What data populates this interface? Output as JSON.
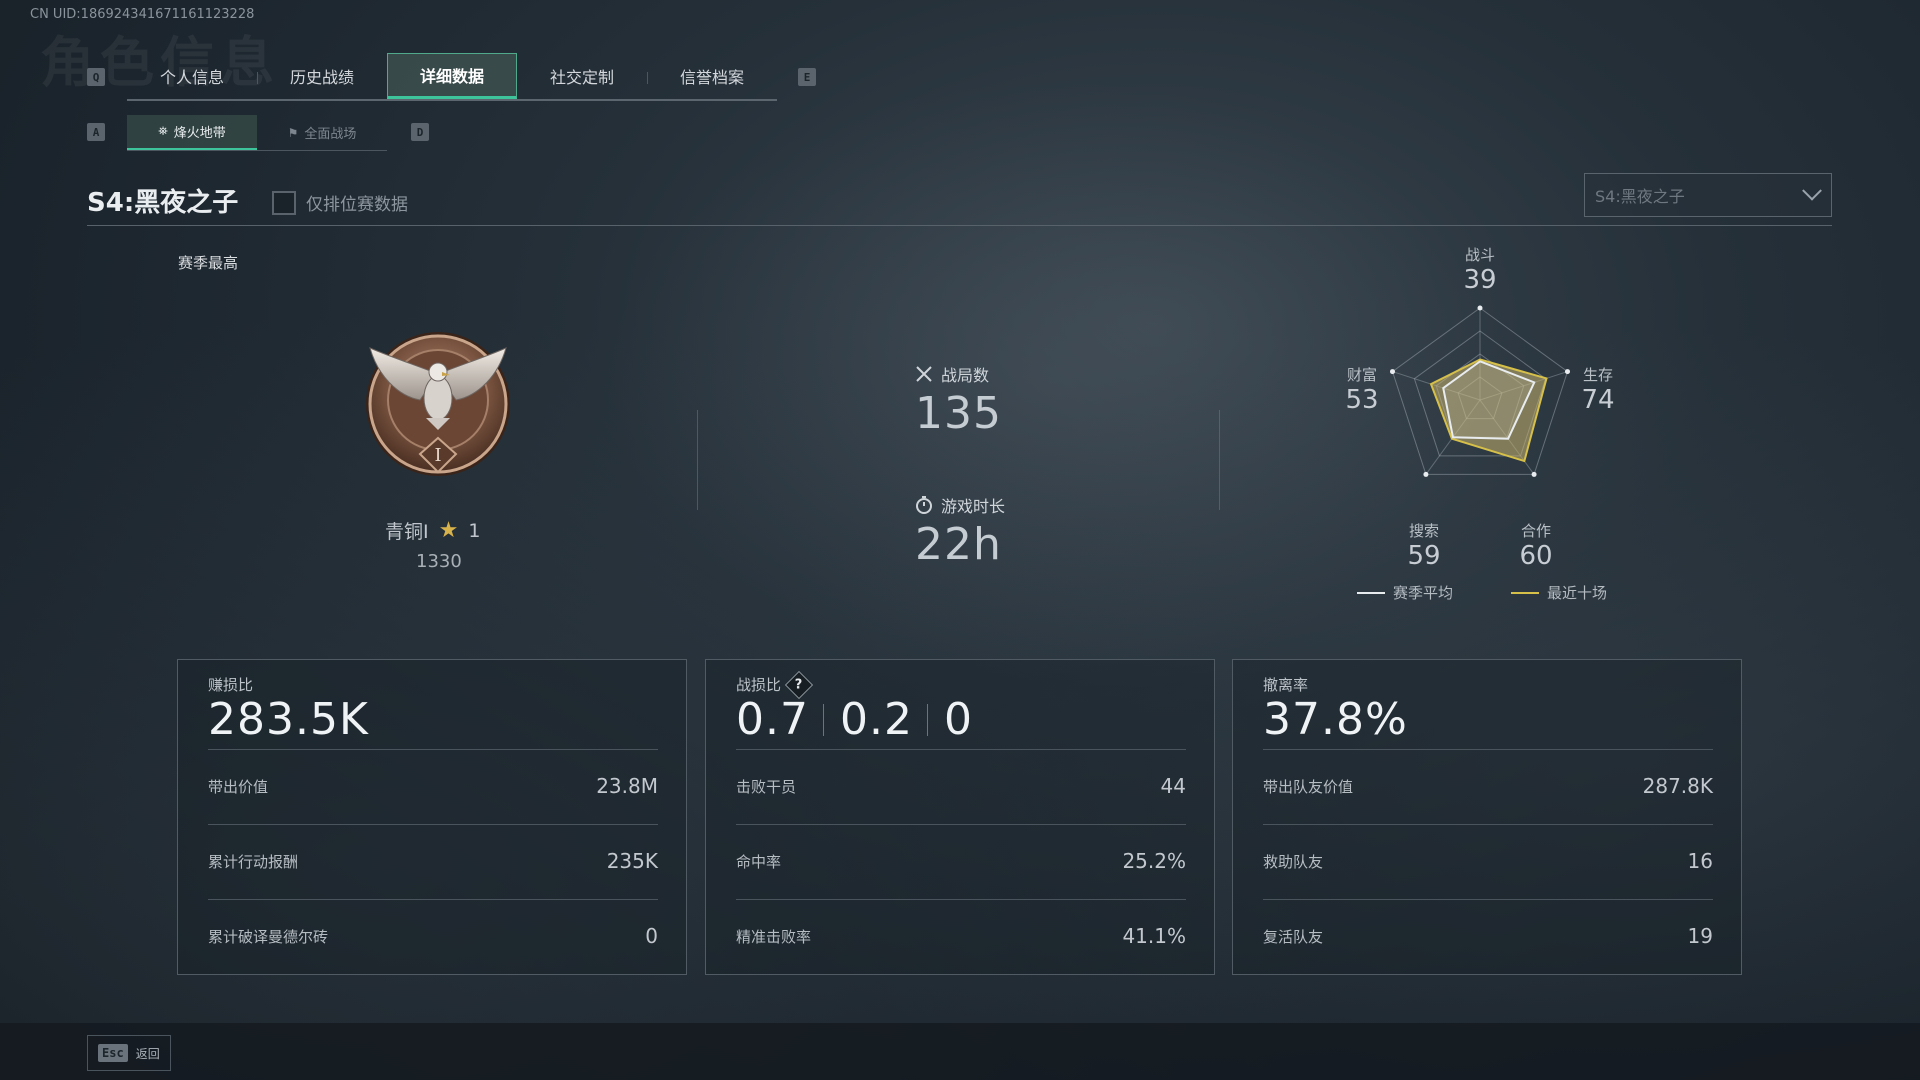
{
  "uid": "CN UID:18692434167116112322​8",
  "ghost_title": "角色信息",
  "tabs": {
    "prev_key": "Q",
    "next_key": "E",
    "items": [
      {
        "label": "个人信息"
      },
      {
        "label": "历史战绩"
      },
      {
        "label": "详细数据"
      },
      {
        "label": "社交定制"
      },
      {
        "label": "信誉档案"
      }
    ]
  },
  "subtabs": {
    "prev_key": "A",
    "next_key": "D",
    "items": [
      {
        "label": "烽火地带",
        "icon": "satellite-icon"
      },
      {
        "label": "全面战场",
        "icon": "crossed-flags-icon"
      }
    ]
  },
  "season": {
    "title": "S4:黑夜之子",
    "rank_only_label": "仅排位赛数据",
    "select_value": "S4:黑夜之子"
  },
  "season_best": {
    "label": "赛季最高",
    "rank_name": "青铜I",
    "stars": "1",
    "points": "1330"
  },
  "overview": {
    "matches_label": "战局数",
    "matches_value": "135",
    "playtime_label": "游戏时长",
    "playtime_value": "22h"
  },
  "radar": {
    "axes": [
      {
        "name": "战斗",
        "value": "39"
      },
      {
        "name": "生存",
        "value": "74"
      },
      {
        "name": "合作",
        "value": "60"
      },
      {
        "name": "搜索",
        "value": "59"
      },
      {
        "name": "财富",
        "value": "53"
      }
    ],
    "season_avg": [
      0.42,
      0.62,
      0.52,
      0.5,
      0.42
    ],
    "recent_ten": [
      0.44,
      0.76,
      0.82,
      0.52,
      0.56
    ],
    "legend_avg": "赛季平均",
    "legend_recent": "最近十场",
    "avg_color": "#e8ecef",
    "recent_color": "#d6c04a"
  },
  "cards": [
    {
      "label": "赚损比",
      "big": "283.5K",
      "rows": [
        {
          "k": "带出价值",
          "v": "23.8M"
        },
        {
          "k": "累计行动报酬",
          "v": "235K"
        },
        {
          "k": "累计破译曼德尔砖",
          "v": "0"
        }
      ]
    },
    {
      "label": "战损比",
      "big_parts": [
        "0.7",
        "0.2",
        "0"
      ],
      "rows": [
        {
          "k": "击败干员",
          "v": "44"
        },
        {
          "k": "命中率",
          "v": "25.2%"
        },
        {
          "k": "精准击败率",
          "v": "41.1%"
        }
      ]
    },
    {
      "label": "撤离率",
      "big": "37.8%",
      "rows": [
        {
          "k": "带出队友价值",
          "v": "287.8K"
        },
        {
          "k": "救助队友",
          "v": "16"
        },
        {
          "k": "复活队友",
          "v": "19"
        }
      ]
    }
  ],
  "bottom": {
    "esc_key": "Esc",
    "back_label": "返回"
  }
}
